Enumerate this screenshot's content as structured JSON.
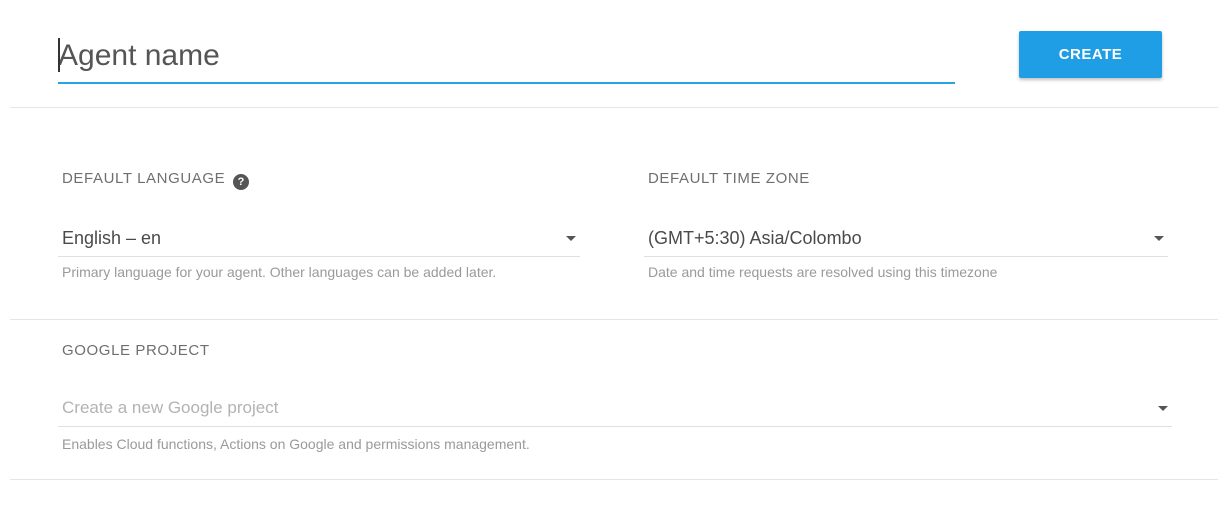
{
  "agent": {
    "name_placeholder": "Agent name",
    "create_label": "CREATE"
  },
  "language": {
    "label": "DEFAULT LANGUAGE",
    "help_icon": "question-circle-icon",
    "value": "English – en",
    "hint": "Primary language for your agent. Other languages can be added later."
  },
  "timezone": {
    "label": "DEFAULT TIME ZONE",
    "value": "(GMT+5:30) Asia/Colombo",
    "hint": "Date and time requests are resolved using this timezone"
  },
  "project": {
    "label": "GOOGLE PROJECT",
    "placeholder": "Create a new Google project",
    "hint": "Enables Cloud functions, Actions on Google and permissions management."
  },
  "colors": {
    "accent": "#1f9ee6",
    "underline": "#29a3e6"
  }
}
